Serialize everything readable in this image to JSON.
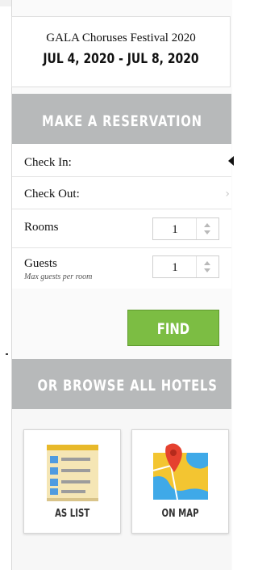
{
  "event": {
    "name": "GALA Choruses Festival 2020",
    "dates": "JUL 4, 2020 - JUL 8, 2020"
  },
  "reservation": {
    "header": "MAKE A RESERVATION",
    "check_in_label": "Check In:",
    "check_out_label": "Check Out:",
    "rooms_label": "Rooms",
    "rooms_value": "1",
    "guests_label": "Guests",
    "guests_sublabel": "Max guests per room",
    "guests_value": "1",
    "find_label": "FIND"
  },
  "browse": {
    "header": "OR BROWSE ALL HOTELS",
    "list_label": "AS LIST",
    "map_label": "ON MAP",
    "list_icon": "list-document-icon",
    "map_icon": "map-pin-icon"
  },
  "colors": {
    "header_bg": "#b7b9ba",
    "find_button": "#7cbd43"
  }
}
